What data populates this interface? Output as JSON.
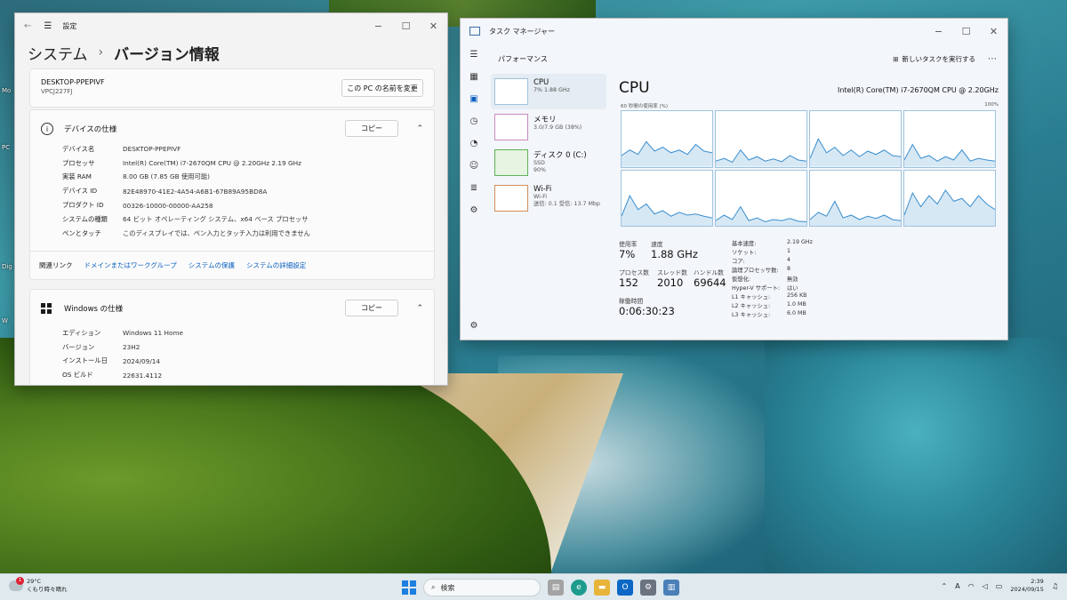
{
  "desktop": {
    "icon_labels": [
      "Mo",
      "PC",
      "Dig",
      "W"
    ]
  },
  "settings": {
    "title": "設定",
    "breadcrumb_parent": "システム",
    "breadcrumb_sep": "›",
    "breadcrumb_current": "バージョン情報",
    "pc_name": "DESKTOP-PPEPIVF",
    "pc_model": "VPCJ227FJ",
    "rename_button": "この PC の名前を変更",
    "device_specs": {
      "heading": "デバイスの仕様",
      "copy_label": "コピー",
      "rows": [
        {
          "k": "デバイス名",
          "v": "DESKTOP-PPEPIVF"
        },
        {
          "k": "プロセッサ",
          "v": "Intel(R) Core(TM) i7-2670QM CPU @ 2.20GHz   2.19 GHz"
        },
        {
          "k": "実装 RAM",
          "v": "8.00 GB (7.85 GB 使用可能)"
        },
        {
          "k": "デバイス ID",
          "v": "82E48970-41E2-4A54-A6B1-67B89A95BD8A"
        },
        {
          "k": "プロダクト ID",
          "v": "00326-10000-00000-AA258"
        },
        {
          "k": "システムの種類",
          "v": "64 ビット オペレーティング システム、x64 ベース プロセッサ"
        },
        {
          "k": "ペンとタッチ",
          "v": "このディスプレイでは、ペン入力とタッチ入力は利用できません"
        }
      ]
    },
    "related_links": {
      "label": "関連リンク",
      "links": [
        "ドメインまたはワークグループ",
        "システムの保護",
        "システムの詳細設定"
      ]
    },
    "windows_specs": {
      "heading": "Windows の仕様",
      "copy_label": "コピー",
      "rows": [
        {
          "k": "エディション",
          "v": "Windows 11 Home"
        },
        {
          "k": "バージョン",
          "v": "23H2"
        },
        {
          "k": "インストール日",
          "v": "2024/09/14"
        },
        {
          "k": "OS ビルド",
          "v": "22631.4112"
        }
      ]
    }
  },
  "taskmgr": {
    "title": "タスク マネージャー",
    "section": "パフォーマンス",
    "new_task": "新しいタスクを実行する",
    "items": [
      {
        "name": "CPU",
        "sub1": "7%  1.88 GHz",
        "sub2": ""
      },
      {
        "name": "メモリ",
        "sub1": "3.0/7.9 GB (38%)",
        "sub2": ""
      },
      {
        "name": "ディスク 0 (C:)",
        "sub1": "SSD",
        "sub2": "90%"
      },
      {
        "name": "Wi-Fi",
        "sub1": "Wi-Fi",
        "sub2": "送信: 0.1  受信: 13.7 Mbp"
      }
    ],
    "cpu_title": "CPU",
    "cpu_model": "Intel(R) Core(TM) i7-2670QM CPU @ 2.20GHz",
    "axis_left": "60 秒間の使用率 (%)",
    "axis_right": "100%",
    "utilization_label": "使用率",
    "utilization": "7%",
    "speed_label": "速度",
    "speed": "1.88 GHz",
    "processes_label": "プロセス数",
    "processes": "152",
    "threads_label": "スレッド数",
    "threads": "2010",
    "handles_label": "ハンドル数",
    "handles": "69644",
    "uptime_label": "稼働時間",
    "uptime": "0:06:30:23",
    "details": [
      {
        "k": "基本速度:",
        "v": "2.19 GHz"
      },
      {
        "k": "ソケット:",
        "v": "1"
      },
      {
        "k": "コア:",
        "v": "4"
      },
      {
        "k": "論理プロセッサ数:",
        "v": "8"
      },
      {
        "k": "仮想化:",
        "v": "無効"
      },
      {
        "k": "Hyper-V サポート:",
        "v": "はい"
      },
      {
        "k": "L1 キャッシュ:",
        "v": "256 KB"
      },
      {
        "k": "L2 キャッシュ:",
        "v": "1.0 MB"
      },
      {
        "k": "L3 キャッシュ:",
        "v": "6.0 MB"
      }
    ],
    "core_graphs": [
      [
        20,
        30,
        22,
        45,
        28,
        35,
        25,
        30,
        22,
        40,
        28,
        25
      ],
      [
        10,
        15,
        8,
        30,
        12,
        18,
        10,
        14,
        9,
        20,
        12,
        10
      ],
      [
        15,
        50,
        25,
        35,
        20,
        30,
        18,
        28,
        22,
        30,
        20,
        18
      ],
      [
        12,
        40,
        15,
        20,
        10,
        18,
        12,
        30,
        10,
        15,
        12,
        10
      ],
      [
        18,
        55,
        30,
        40,
        22,
        28,
        18,
        25,
        20,
        22,
        18,
        15
      ],
      [
        10,
        20,
        12,
        35,
        10,
        15,
        8,
        12,
        10,
        14,
        9,
        8
      ],
      [
        12,
        25,
        18,
        45,
        15,
        20,
        12,
        18,
        14,
        20,
        12,
        10
      ],
      [
        20,
        60,
        35,
        55,
        40,
        65,
        45,
        50,
        35,
        55,
        40,
        30
      ]
    ]
  },
  "taskbar": {
    "temp": "29°C",
    "weather": "くもり時々晴れ",
    "badge": "1",
    "search": "検索",
    "ime": "A",
    "time": "2:39",
    "date": "2024/09/15"
  }
}
